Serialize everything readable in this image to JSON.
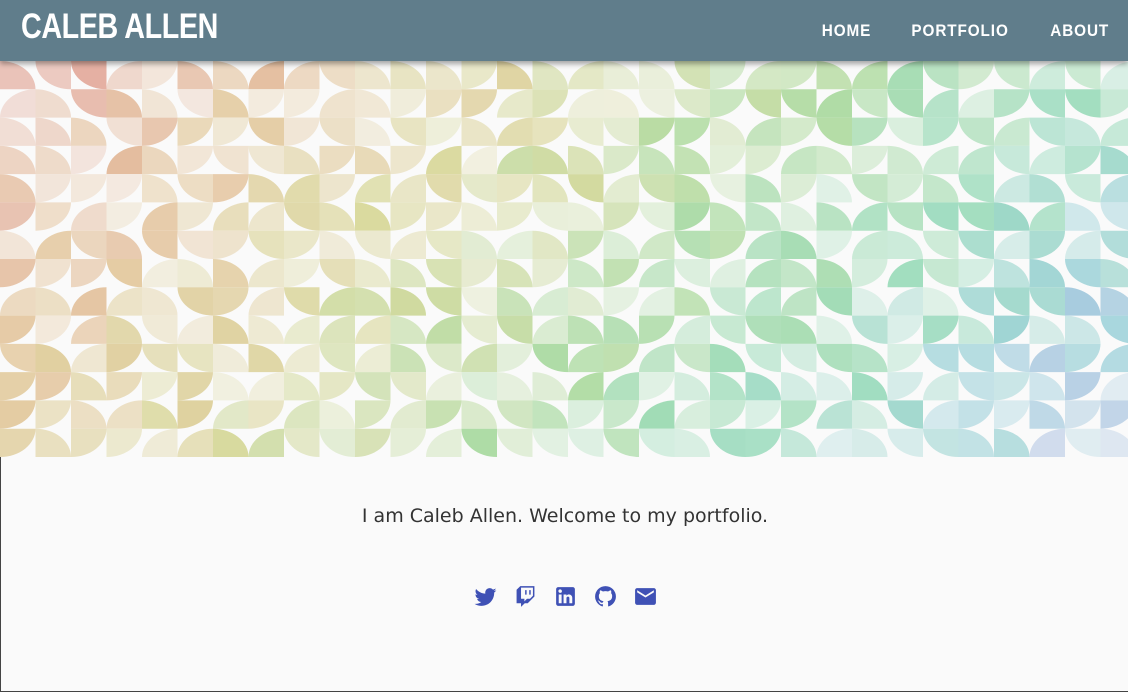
{
  "navbar": {
    "brand": "CALEB ALLEN",
    "links": [
      {
        "label": "HOME"
      },
      {
        "label": "PORTFOLIO"
      },
      {
        "label": "ABOUT"
      }
    ],
    "background_color": "#607d8b"
  },
  "hero": {
    "pattern": "quarter-circle mosaic",
    "colors": [
      "#e0a090",
      "#e0c890",
      "#c8dc90",
      "#90dca0",
      "#90d4d0",
      "#a0b4e0",
      "#d4c8ec"
    ]
  },
  "main": {
    "welcome_text": "I am Caleb Allen. Welcome to my portfolio.",
    "social_links": [
      {
        "icon": "twitter-icon"
      },
      {
        "icon": "twitch-icon"
      },
      {
        "icon": "linkedin-icon"
      },
      {
        "icon": "github-icon"
      },
      {
        "icon": "email-icon"
      }
    ],
    "accent_color": "#3f51b5"
  }
}
